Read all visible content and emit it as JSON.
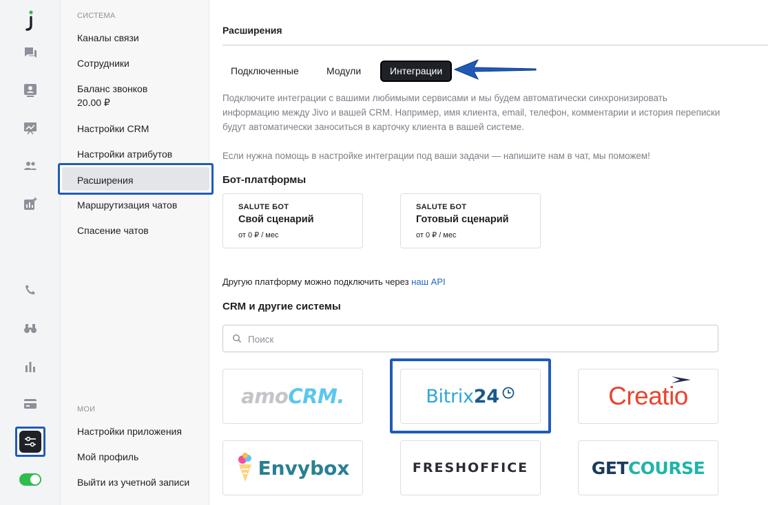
{
  "rail": {
    "icons": [
      "jivo-logo",
      "chat-icon",
      "contact-card-icon",
      "analytics-board-icon",
      "team-icon",
      "reports-sparkle-icon",
      "phone-icon",
      "binoculars-icon",
      "bar-chart-icon",
      "billing-card-icon",
      "settings-sliders-icon"
    ],
    "toggle_on": true,
    "colors": {
      "accent": "#1f5bb6",
      "toggle": "#2fbd4d",
      "logo_dot": "#2fbd4d"
    }
  },
  "nav": {
    "group_system": "СИСТЕМА",
    "items": [
      {
        "label": "Каналы связи"
      },
      {
        "label": "Сотрудники"
      },
      {
        "label": "Баланс звонков",
        "sub": "20.00 ₽"
      },
      {
        "label": "Настройки CRM"
      },
      {
        "label": "Настройки атрибутов"
      },
      {
        "label": "Расширения",
        "active": true
      },
      {
        "label": "Маршрутизация чатов"
      },
      {
        "label": "Спасение чатов"
      }
    ],
    "group_mine": "МОИ",
    "mine_items": [
      {
        "label": "Настройки приложения"
      },
      {
        "label": "Мой профиль"
      },
      {
        "label": "Выйти из учетной записи"
      }
    ]
  },
  "main": {
    "title": "Расширения",
    "tabs": [
      {
        "label": "Подключенные"
      },
      {
        "label": "Модули"
      },
      {
        "label": "Интеграции",
        "active": true
      }
    ],
    "description": [
      "Подключите интеграции с вашими любимыми сервисами и мы будем автоматически синхронизировать",
      "информацию между Jivo и вашей CRM. Например, имя клиента, email, телефон, комментарии и история переписки",
      "будут автоматически заноситься в карточку клиента в вашей системе."
    ],
    "help_text": "Если нужна помощь в настройке интеграции под ваши задачи — напишите нам в чат, мы поможем!",
    "bot_section": {
      "title": "Бот-платформы",
      "cards": [
        {
          "tag": "SALUTE БОТ",
          "name": "Свой сценарий",
          "price": "от 0 ₽ / мес"
        },
        {
          "tag": "SALUTE БОТ",
          "name": "Готовый сценарий",
          "price": "от 0 ₽ / мес"
        }
      ]
    },
    "api_text": "Другую платформу можно подключить через",
    "api_link": "наш API",
    "crm_section": {
      "title": "CRM и другие системы",
      "search_placeholder": "Поиск",
      "integrations": [
        {
          "name": "amoCRM",
          "logo_a": "amo",
          "logo_b": "CRM."
        },
        {
          "name": "Bitrix24",
          "logo_a": "Bitrix",
          "logo_b": "24",
          "highlighted": true
        },
        {
          "name": "Creatio",
          "logo_a": "Creatio"
        },
        {
          "name": "Envybox",
          "logo_a": "Envybox"
        },
        {
          "name": "FreshOffice",
          "logo_a": "FRESHOFFICE"
        },
        {
          "name": "GetCourse",
          "logo_a": "GET",
          "logo_b": "COURSE"
        }
      ]
    }
  }
}
